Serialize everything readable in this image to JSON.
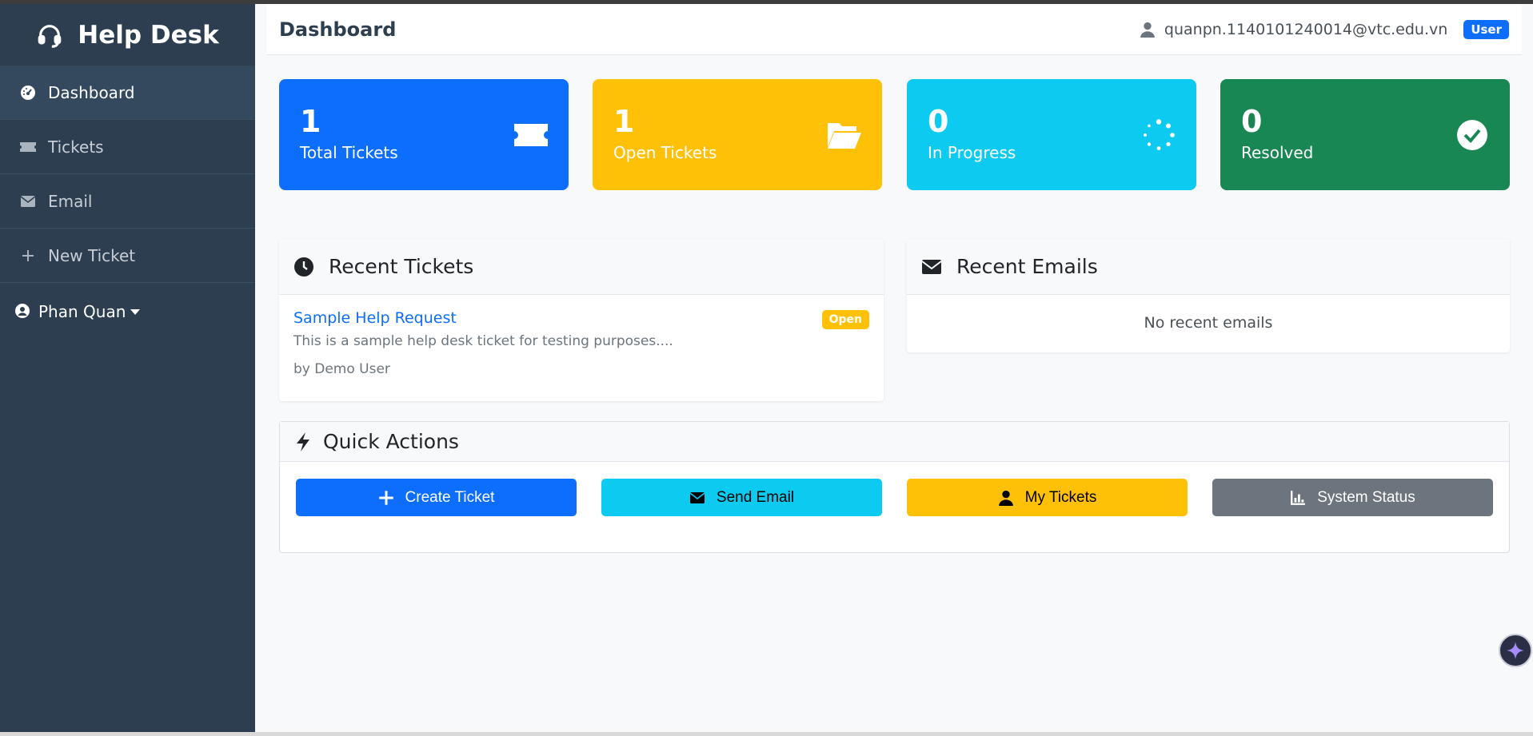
{
  "app": {
    "brand": "Help Desk"
  },
  "sidebar": {
    "items": [
      {
        "label": "Dashboard",
        "icon": "gauge-icon",
        "active": true
      },
      {
        "label": "Tickets",
        "icon": "ticket-icon"
      },
      {
        "label": "Email",
        "icon": "envelope-icon"
      },
      {
        "label": "New Ticket",
        "icon": "plus-icon"
      }
    ],
    "user": {
      "name": "Phan Quan",
      "icon": "user-circle-icon"
    }
  },
  "header": {
    "title": "Dashboard",
    "email": "quanpn.1140101240014@vtc.edu.vn",
    "role_badge": "User"
  },
  "stats": [
    {
      "value": "1",
      "label": "Total Tickets",
      "icon": "ticket-icon",
      "color": "#0d6efd"
    },
    {
      "value": "1",
      "label": "Open Tickets",
      "icon": "folder-open-icon",
      "color": "#ffc107"
    },
    {
      "value": "0",
      "label": "In Progress",
      "icon": "spinner-icon",
      "color": "#0dcaf0"
    },
    {
      "value": "0",
      "label": "Resolved",
      "icon": "check-circle-icon",
      "color": "#198754"
    }
  ],
  "recent_tickets": {
    "title": "Recent Tickets",
    "items": [
      {
        "title": "Sample Help Request",
        "status": "Open",
        "description": "This is a sample help desk ticket for testing purposes....",
        "author": "by Demo User"
      }
    ]
  },
  "recent_emails": {
    "title": "Recent Emails",
    "empty_text": "No recent emails"
  },
  "quick_actions": {
    "title": "Quick Actions",
    "buttons": [
      {
        "label": "Create Ticket",
        "icon": "plus-icon",
        "color": "#0d6efd"
      },
      {
        "label": "Send Email",
        "icon": "envelope-icon",
        "color": "#0dcaf0"
      },
      {
        "label": "My Tickets",
        "icon": "user-icon",
        "color": "#ffc107"
      },
      {
        "label": "System Status",
        "icon": "chart-bar-icon",
        "color": "#6c757d"
      }
    ]
  }
}
